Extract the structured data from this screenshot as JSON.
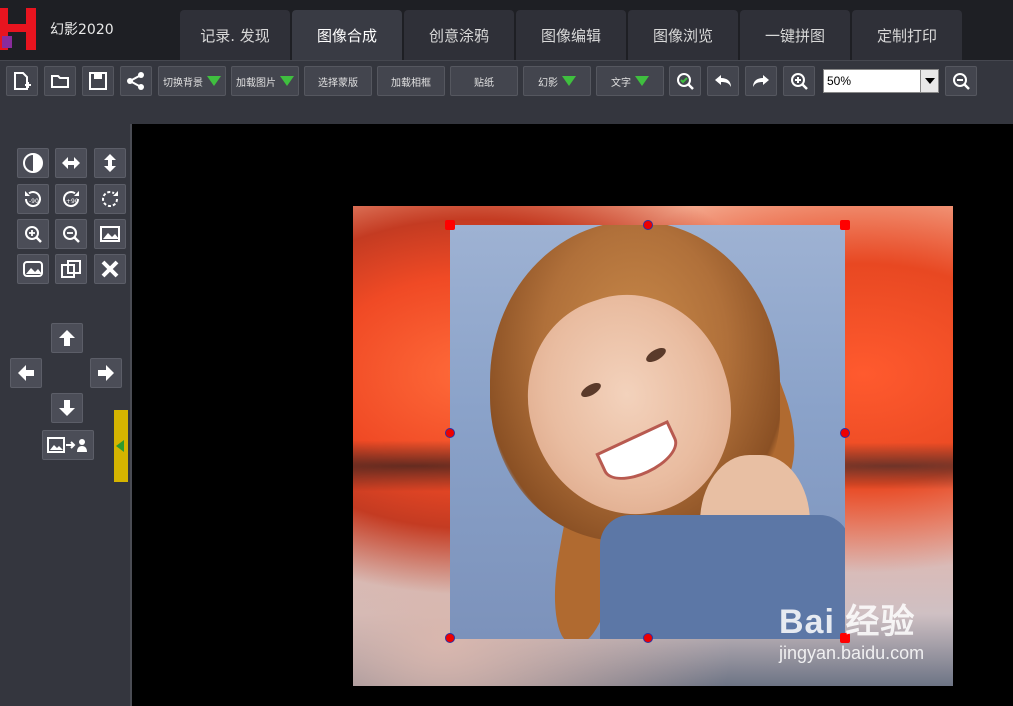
{
  "app": {
    "title": "幻影2020"
  },
  "tabs": [
    {
      "label": "记录. 发现"
    },
    {
      "label": "图像合成"
    },
    {
      "label": "创意涂鸦"
    },
    {
      "label": "图像编辑"
    },
    {
      "label": "图像浏览"
    },
    {
      "label": "一键拼图"
    },
    {
      "label": "定制打印"
    }
  ],
  "toolbar": {
    "switch_background": "切换背景",
    "load_image": "加载图片",
    "select_template": "选择蒙版",
    "load_frame": "加载相框",
    "sticker": "贴纸",
    "phantom": "幻影",
    "text": "文字",
    "zoom_value": "50%"
  },
  "watermark": {
    "brand": "Bai  经验",
    "url": "jingyan.baidu.com"
  },
  "colors": {
    "accent": "#ff0000",
    "dropdown_arrow": "#3fbf3f",
    "panel": "#34363e",
    "tab_active": "#393b44"
  }
}
